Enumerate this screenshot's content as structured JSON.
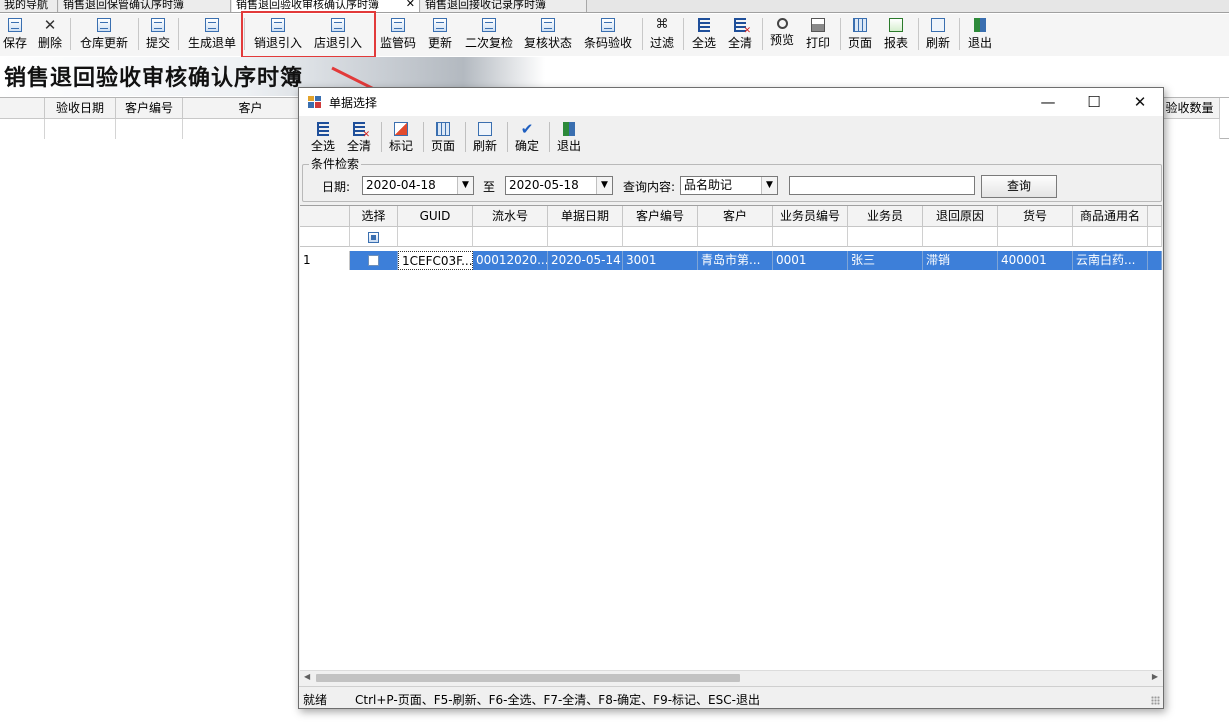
{
  "tabs": [
    {
      "label": "我的导航"
    },
    {
      "label": "销售退回保管确认序时簿"
    },
    {
      "label": "销售退回验收审核确认序时簿",
      "close": "✕"
    },
    {
      "label": "销售退回接收记录序时簿"
    }
  ],
  "toolbar": {
    "save": "保存",
    "delete": "删除",
    "warehouse_update": "仓库更新",
    "submit": "提交",
    "generate_return": "生成退单",
    "sales_return_import": "销退引入",
    "store_return_import": "店退引入",
    "supervision_code": "监管码",
    "update": "更新",
    "second_recheck": "二次复检",
    "recheck_status": "复核状态",
    "barcode_check": "条码验收",
    "filter": "过滤",
    "select_all": "全选",
    "clear_all": "全清",
    "preview": "预览",
    "print": "打印",
    "page": "页面",
    "report": "报表",
    "refresh": "刷新",
    "exit": "退出"
  },
  "banner": {
    "title": "销售退回验收审核确认序时簿"
  },
  "background_grid": {
    "headers": [
      "验收日期",
      "客户编号",
      "客户",
      "验收数量"
    ]
  },
  "dialog": {
    "title": "单据选择",
    "window_controls": {
      "minimize": "—",
      "maximize": "☐",
      "close": "✕"
    },
    "toolbar": {
      "select_all": "全选",
      "clear_all": "全清",
      "mark": "标记",
      "page": "页面",
      "refresh": "刷新",
      "confirm": "确定",
      "exit": "退出"
    },
    "filter": {
      "legend": "条件检索",
      "date_label": "日期:",
      "date_from": "2020-04-18",
      "to_label": "至",
      "date_to": "2020-05-18",
      "query_label": "查询内容:",
      "query_field": "品名助记",
      "query_value": "",
      "query_button": "查询"
    },
    "grid": {
      "headers": [
        "",
        "选择",
        "GUID",
        "流水号",
        "单据日期",
        "客户编号",
        "客户",
        "业务员编号",
        "业务员",
        "退回原因",
        "货号",
        "商品通用名"
      ],
      "rows": [
        {
          "row_no": "1",
          "guid": "1CEFC03F...",
          "serial": "00012020...",
          "date": "2020-05-14",
          "customer_no": "3001",
          "customer": "青岛市第...",
          "salesman_no": "0001",
          "salesman": "张三",
          "reason": "滞销",
          "item_no": "400001",
          "generic_name": "云南白药..."
        }
      ]
    },
    "status": {
      "ready": "就绪",
      "shortcuts": "Ctrl+P-页面、F5-刷新、F6-全选、F7-全清、F8-确定、F9-标记、ESC-退出"
    }
  },
  "colors": {
    "highlight": "#e23a3a",
    "selected_row": "#3d7fd9",
    "arrow": "#e23a3a"
  }
}
